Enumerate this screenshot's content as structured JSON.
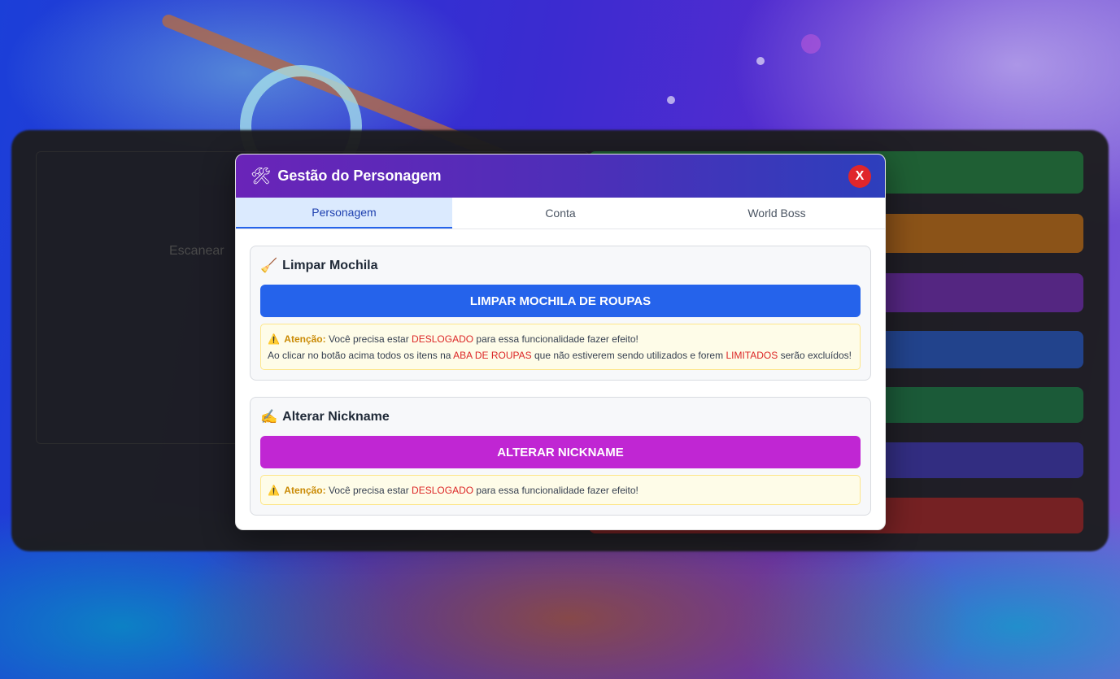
{
  "modal": {
    "title": "Gestão do Personagem",
    "title_icon": "tools-icon",
    "close_label": "X"
  },
  "tabs": [
    {
      "label": "Personagem",
      "active": true
    },
    {
      "label": "Conta",
      "active": false
    },
    {
      "label": "World Boss",
      "active": false
    }
  ],
  "background": {
    "blurred_text": "Escanear"
  },
  "limpar": {
    "icon": "broom-icon",
    "title": "Limpar Mochila",
    "button_label": "LIMPAR MOCHILA DE ROUPAS",
    "warning": {
      "label": "Atenção:",
      "line1_a": "Você precisa estar",
      "line1_red": "DESLOGADO",
      "line1_b": "para essa funcionalidade fazer efeito!",
      "line2_a": "Ao clicar no botão acima todos os itens na",
      "line2_red1": "ABA DE ROUPAS",
      "line2_b": "que não estiverem sendo utilizados e forem",
      "line2_red2": "LIMITADOS",
      "line2_c": "serão excluídos!"
    }
  },
  "nickname": {
    "icon": "writing-hand-icon",
    "title": "Alterar Nickname",
    "button_label": "ALTERAR NICKNAME",
    "warning": {
      "label": "Atenção:",
      "line1_a": "Você precisa estar",
      "line1_red": "DESLOGADO",
      "line1_b": "para essa funcionalidade fazer efeito!"
    }
  },
  "colors": {
    "header_start": "#6a24b8",
    "header_end": "#2d3fbc",
    "close": "#e0262b",
    "button_blue": "#2563eb",
    "button_purple": "#c026d3",
    "warning_text": "#dc2626"
  }
}
